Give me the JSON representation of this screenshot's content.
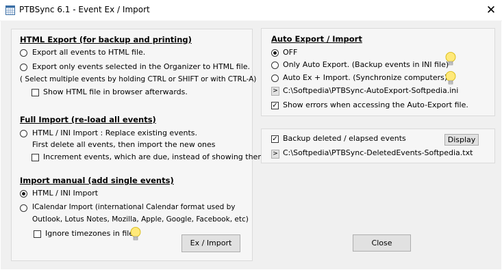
{
  "window": {
    "title": "PTBSync 6.1 - Event Ex / Import",
    "close_glyph": "✕"
  },
  "html_export": {
    "header": "HTML Export   (for backup and printing)",
    "opt_all": "Export all events to HTML file.",
    "opt_selected": "Export only events selected in the Organizer to HTML file.",
    "hint": "( Select multiple events by holding CTRL or SHIFT or with CTRL-A)",
    "show_browser": "Show HTML file in browser afterwards."
  },
  "full_import": {
    "header": "Full Import    (re-load all events)",
    "opt_replace": "HTML / INI Import : Replace existing events.",
    "note": "First delete all events, then import the new ones",
    "increment": "Increment events, which are due, instead of showing them."
  },
  "import_manual": {
    "header": "Import manual    (add single events)",
    "opt_html_ini": "HTML / INI Import",
    "opt_icalendar": "ICalendar Import    (international Calendar format used by",
    "opt_icalendar_cont": "Outlook, Lotus Notes, Mozilla, Apple, Google, Facebook, etc)",
    "ignore_tz": "Ignore timezones in file",
    "button": "Ex / Import"
  },
  "auto_export": {
    "header": "Auto Export / Import",
    "opt_off": "OFF",
    "opt_only": "Only Auto Export.    (Backup events in INI file)",
    "opt_ex_im": "Auto Ex + Import.    (Synchronize computers)",
    "path": "C:\\Softpedia\\PTBSync-AutoExport-Softpedia.ini",
    "show_errors": "Show errors when accessing the Auto-Export file.",
    "arrow_glyph": ">"
  },
  "backup": {
    "label": "Backup deleted / elapsed  events",
    "display_button": "Display",
    "path": "C:\\Softpedia\\PTBSync-DeletedEvents-Softpedia.txt",
    "arrow_glyph": ">"
  },
  "close_button": "Close",
  "state": {
    "html_export_choice": "none",
    "show_browser": false,
    "full_import_selected": false,
    "increment": false,
    "import_manual_choice": "html_ini",
    "ignore_tz": false,
    "auto_export_choice": "off",
    "show_errors": true,
    "backup_deleted": true
  },
  "check_glyph": "✓",
  "colors": {
    "panel": "#f6f6f6",
    "dialog": "#f0f0f0",
    "button": "#e1e1e1",
    "bulb": "#ffe97a"
  }
}
